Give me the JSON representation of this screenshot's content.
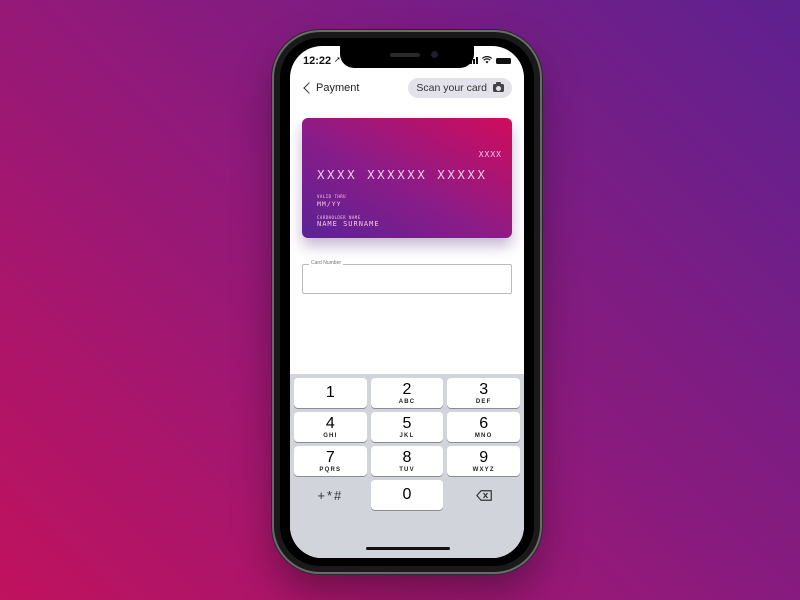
{
  "status_bar": {
    "time": "12:22",
    "location_icon": "location-arrow-icon",
    "icons": [
      "signal-icon",
      "wifi-icon",
      "battery-icon"
    ]
  },
  "nav": {
    "back_label": "Payment",
    "scan_label": "Scan your card",
    "scan_icon": "camera-icon"
  },
  "card": {
    "last_digits": "XXXX",
    "number": "XXXX XXXXXX XXXXX",
    "valid_label": "VALID THRU",
    "valid": "MM/YY",
    "holder_label": "CARDHOLDER NAME",
    "holder": "NAME SURNAME",
    "gradient": [
      "#5b2294",
      "#8a1c88",
      "#d00c5c"
    ]
  },
  "form": {
    "card_number_label": "Card Number",
    "card_number_value": ""
  },
  "keyboard": {
    "keys": [
      {
        "num": "1",
        "letters": ""
      },
      {
        "num": "2",
        "letters": "ABC"
      },
      {
        "num": "3",
        "letters": "DEF"
      },
      {
        "num": "4",
        "letters": "GHI"
      },
      {
        "num": "5",
        "letters": "JKL"
      },
      {
        "num": "6",
        "letters": "MNO"
      },
      {
        "num": "7",
        "letters": "PQRS"
      },
      {
        "num": "8",
        "letters": "TUV"
      },
      {
        "num": "9",
        "letters": "WXYZ"
      }
    ],
    "symbols": "+*#",
    "zero": "0",
    "delete_icon": "backspace-icon"
  },
  "colors": {
    "background_start": "#c0125e",
    "background_end": "#5e2190",
    "keyboard_bg": "#d2d4db",
    "scan_button_bg": "#e3e1ea"
  }
}
